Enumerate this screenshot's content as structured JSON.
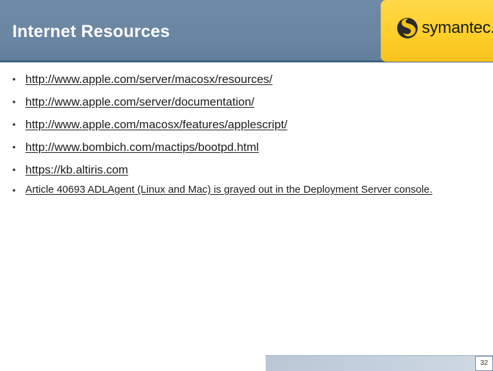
{
  "slide": {
    "title": "Internet Resources",
    "page_number": "32"
  },
  "logo": {
    "text": "symantec."
  },
  "links": [
    {
      "text": "http://www.apple.com/server/macosx/resources/"
    },
    {
      "text": "http://www.apple.com/server/documentation/"
    },
    {
      "text": "http://www.apple.com/macosx/features/applescript/"
    },
    {
      "text": "http://www.bombich.com/mactips/bootpd.html"
    },
    {
      "text": "https://kb.altiris.com"
    },
    {
      "text": "Article 40693 ADLAgent (Linux and Mac) is grayed out in the Deployment Server console."
    }
  ],
  "bullet_symbol": "•",
  "colors": {
    "header": "#6f8aa6",
    "logo_panel": "#ffd23a",
    "text": "#1b1b1b"
  }
}
